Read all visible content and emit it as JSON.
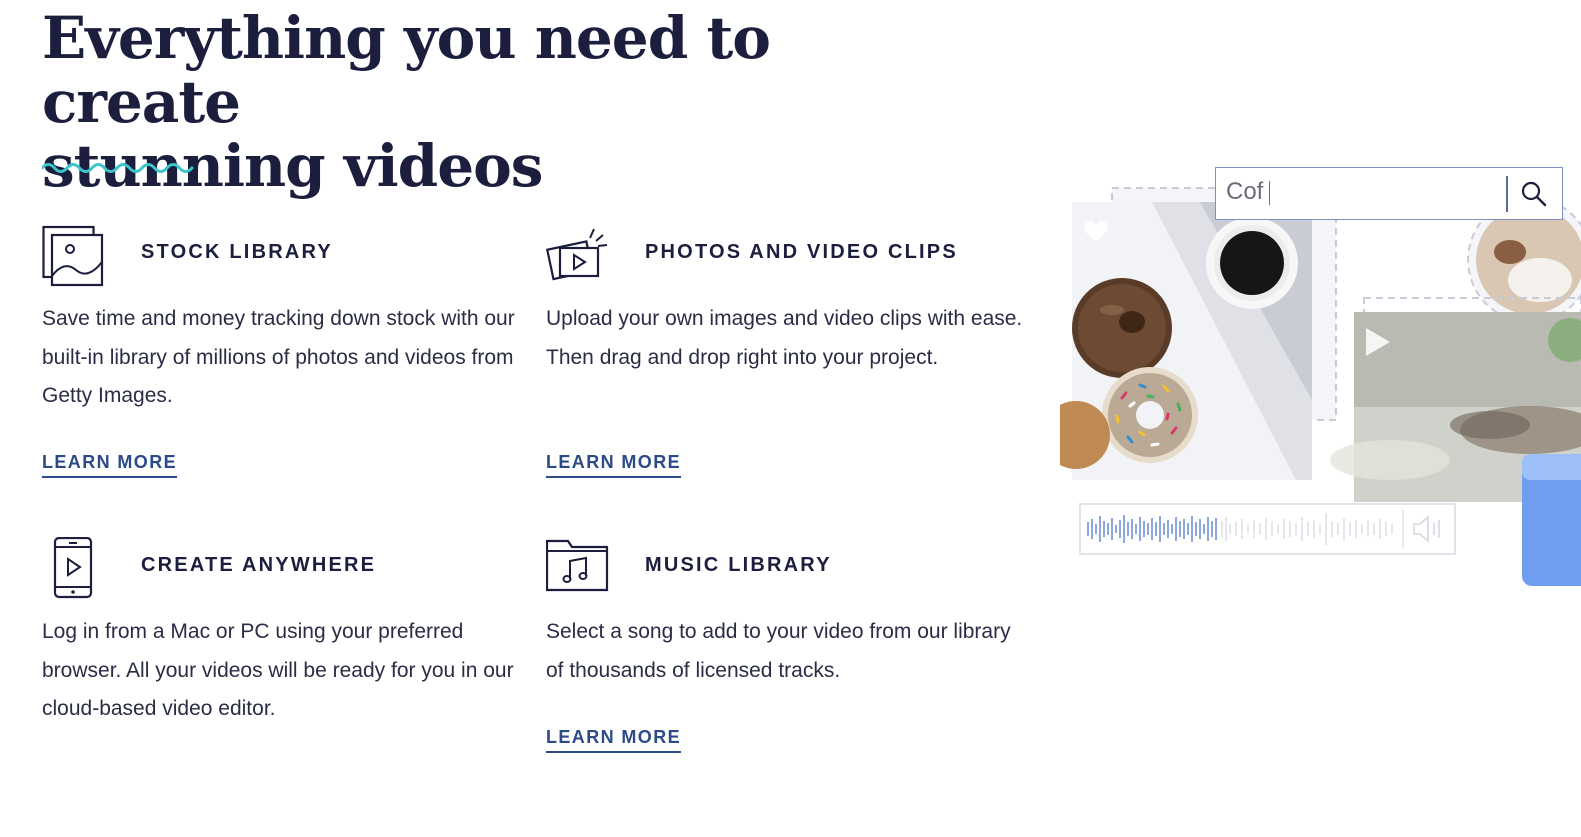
{
  "headline": {
    "line1": "Everything you need to create",
    "line2": "stunning videos"
  },
  "features": [
    {
      "title": "STOCK LIBRARY",
      "description": "Save time and money tracking down stock with our built-in library of millions of photos and videos from Getty Images.",
      "link": "LEARN MORE",
      "icon": "stock-library-icon"
    },
    {
      "title": "PHOTOS AND VIDEO CLIPS",
      "description": "Upload your own images and video clips with ease. Then drag and drop right into your project.",
      "link": "LEARN MORE",
      "icon": "photos-video-clips-icon"
    },
    {
      "title": "CREATE ANYWHERE",
      "description": "Log in from a Mac or PC using your preferred browser. All your videos will be ready for you in our cloud-based video editor.",
      "icon": "mobile-device-icon"
    },
    {
      "title": "MUSIC LIBRARY",
      "description": "Select a song to add to your video from our library of thousands of licensed tracks.",
      "link": "LEARN MORE",
      "icon": "music-folder-icon"
    }
  ],
  "illustration": {
    "search_value": "Cof"
  },
  "colors": {
    "headline": "#1b1e3d",
    "accent_wave": "#3cc4c8",
    "link": "#2b4a86",
    "search_border": "#7f8fc4",
    "waveform_active": "#6f8fe0",
    "tab_blue": "#6f9ef0"
  }
}
